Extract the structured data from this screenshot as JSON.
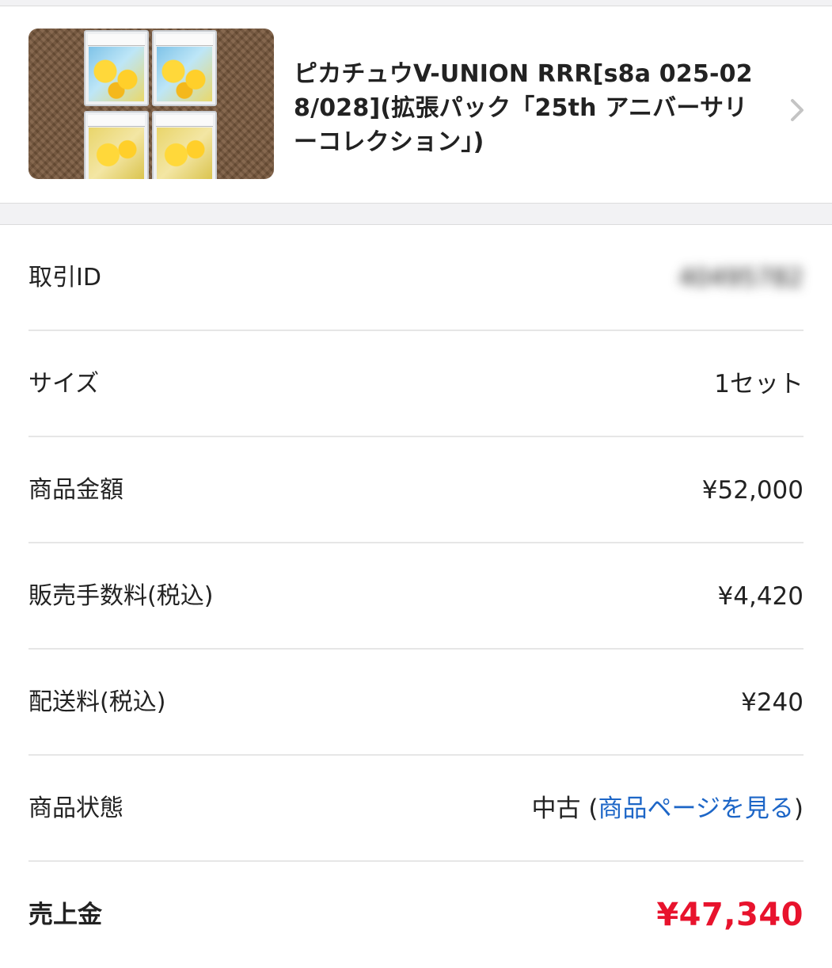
{
  "product": {
    "title": "ピカチュウV-UNION RRR[s8a 025-028/028](拡張パック「25th アニバーサリーコレクション」)",
    "thumbnail_icon": "pikachu-card-slabs-photo",
    "chevron_icon": "chevron-right-icon"
  },
  "details": {
    "transaction_id": {
      "label": "取引ID",
      "value": "40495782"
    },
    "size": {
      "label": "サイズ",
      "value": "1セット"
    },
    "item_price": {
      "label": "商品金額",
      "value": "¥52,000"
    },
    "sales_fee": {
      "label": "販売手数料(税込)",
      "value": "¥4,420"
    },
    "shipping_fee": {
      "label": "配送料(税込)",
      "value": "¥240"
    },
    "condition": {
      "label": "商品状態",
      "value": "中古",
      "paren_open": " (",
      "link": "商品ページを見る",
      "paren_close": ")"
    },
    "proceeds": {
      "label": "売上金",
      "value": "¥47,340"
    }
  },
  "colors": {
    "link": "#1d66c7",
    "proceeds": "#e8132d",
    "band": "#f2f2f4"
  }
}
